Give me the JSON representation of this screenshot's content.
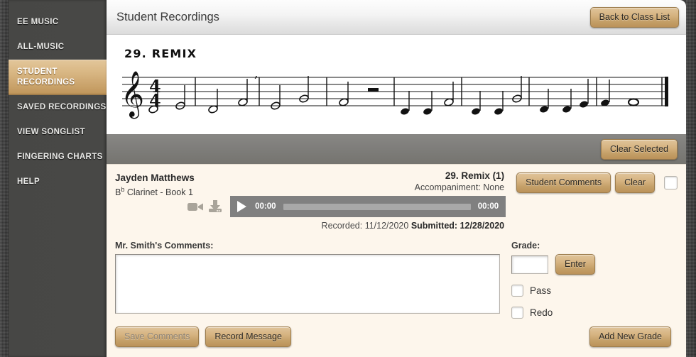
{
  "sidebar": {
    "items": [
      {
        "label": "EE Music",
        "name": "ee-music",
        "active": false
      },
      {
        "label": "All-Music",
        "name": "all-music",
        "active": false
      },
      {
        "label": "Student Recordings",
        "name": "student-recordings",
        "active": true
      },
      {
        "label": "Saved Recordings",
        "name": "saved-recordings",
        "active": false
      },
      {
        "label": "View Songlist",
        "name": "view-songlist",
        "active": false
      },
      {
        "label": "Fingering Charts",
        "name": "fingering-charts",
        "active": false
      },
      {
        "label": "Help",
        "name": "help",
        "active": false
      }
    ]
  },
  "header": {
    "title": "Student Recordings",
    "back_button": "Back to Class List"
  },
  "sheet_music": {
    "title": "29.  REMIX",
    "clef": "treble-clef",
    "time_signature": "4/4"
  },
  "toolbar": {
    "clear_selected": "Clear Selected"
  },
  "recording": {
    "student_name": "Jayden Matthews",
    "instrument_prefix": "B",
    "instrument_superscript": "b",
    "instrument_rest": " Clarinet - Book 1",
    "song": "29. Remix (1)",
    "accompaniment": "Accompaniment: None",
    "player": {
      "current_time": "00:00",
      "total_time": "00:00",
      "progress_percent": 0
    },
    "recorded_label": "Recorded: 11/12/2020",
    "submitted_label": "Submitted: 12/28/2020",
    "student_comments_button": "Student Comments",
    "clear_button": "Clear",
    "select_checkbox_checked": false
  },
  "comments": {
    "label": "Mr. Smith's Comments:",
    "value": "",
    "placeholder": ""
  },
  "grade": {
    "label": "Grade:",
    "value": "",
    "enter_button": "Enter",
    "pass_label": "Pass",
    "pass_checked": false,
    "redo_label": "Redo",
    "redo_checked": false
  },
  "actions": {
    "save_comments": "Save Comments",
    "save_comments_disabled": true,
    "record_message": "Record Message",
    "add_new_grade": "Add New Grade"
  },
  "colors": {
    "accent_tan": "#c9a26a",
    "sidebar_bg": "#464644",
    "content_bg": "#fdf6ec",
    "subbar_gray": "#7e7d7a",
    "player_gray": "#808080"
  }
}
